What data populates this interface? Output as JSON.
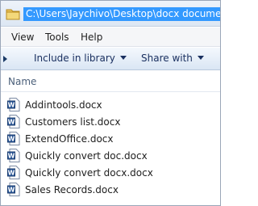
{
  "address_bar": {
    "path": "C:\\Users\\Jaychivo\\Desktop\\docx documents",
    "icon": "folder-icon"
  },
  "menu": {
    "items": [
      "View",
      "Tools",
      "Help"
    ]
  },
  "command_bar": {
    "include_label": "Include in library",
    "share_label": "Share with"
  },
  "columns": {
    "name": "Name"
  },
  "files": [
    {
      "name": "Addintools.docx",
      "icon": "word-doc-icon"
    },
    {
      "name": "Customers list.docx",
      "icon": "word-doc-icon"
    },
    {
      "name": "ExtendOffice.docx",
      "icon": "word-doc-icon"
    },
    {
      "name": "Quickly convert doc.docx",
      "icon": "word-doc-icon"
    },
    {
      "name": "Quickly convert docx.docx",
      "icon": "word-doc-icon"
    },
    {
      "name": "Sales Records.docx",
      "icon": "word-doc-icon"
    }
  ],
  "colors": {
    "selection": "#3399ff",
    "header_text": "#4c607a",
    "command_text": "#1a3060"
  }
}
